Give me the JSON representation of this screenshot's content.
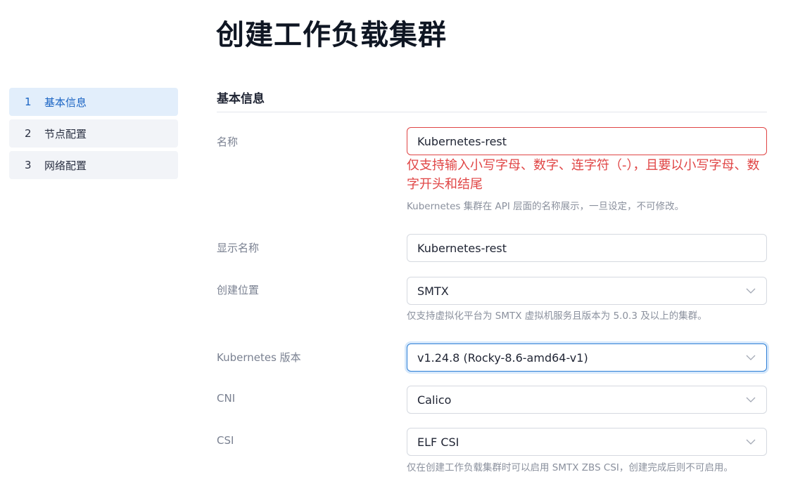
{
  "page": {
    "title": "创建工作负载集群"
  },
  "steps": [
    {
      "num": "1",
      "label": "基本信息"
    },
    {
      "num": "2",
      "label": "节点配置"
    },
    {
      "num": "3",
      "label": "网络配置"
    }
  ],
  "section": {
    "title": "基本信息"
  },
  "fields": {
    "name": {
      "label": "名称",
      "value": "Kubernetes-rest",
      "error": "仅支持输入小写字母、数字、连字符（-），且要以小写字母、数字开头和结尾",
      "hint": "Kubernetes 集群在 API 层面的名称展示，一旦设定，不可修改。"
    },
    "display_name": {
      "label": "显示名称",
      "value": "Kubernetes-rest"
    },
    "location": {
      "label": "创建位置",
      "value": "SMTX",
      "hint": "仅支持虚拟化平台为 SMTX 虚拟机服务且版本为 5.0.3 及以上的集群。"
    },
    "k8s_version": {
      "label": "Kubernetes 版本",
      "value": "v1.24.8 (Rocky-8.6-amd64-v1)"
    },
    "cni": {
      "label": "CNI",
      "value": "Calico"
    },
    "csi": {
      "label": "CSI",
      "value": "ELF CSI",
      "hint": "仅在创建工作负载集群时可以启用 SMTX ZBS CSI，创建完成后则不可启用。"
    }
  },
  "icons": {
    "select_arrow": "chevron-down-icon"
  },
  "colors": {
    "accent": "#1a64c4",
    "error": "#e04545",
    "active_step_bg": "#e2eefb",
    "focus_border": "#2d7fd6"
  }
}
